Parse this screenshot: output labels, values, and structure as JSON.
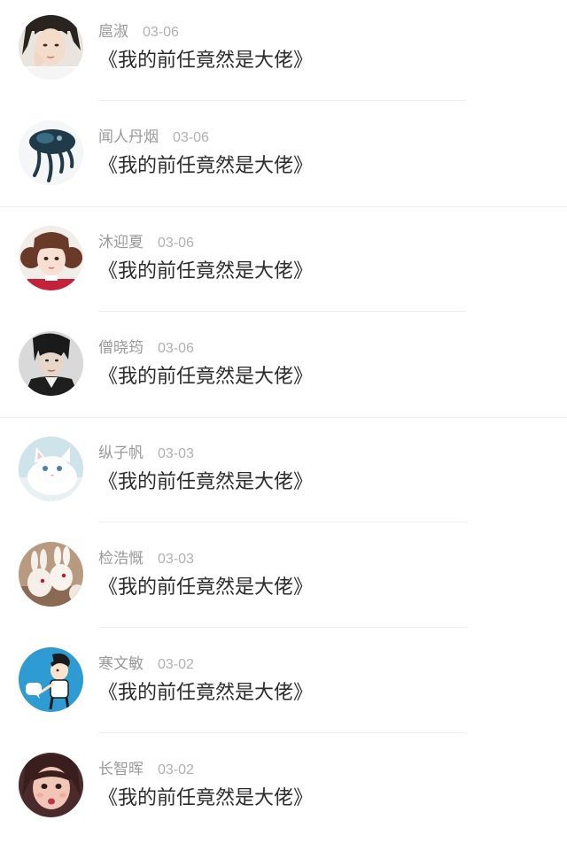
{
  "comments": [
    {
      "user": "扈淑",
      "date": "03-06",
      "book": "《我的前任竟然是大佬》",
      "avatar_icon": "girl-portrait-icon"
    },
    {
      "user": "闻人丹烟",
      "date": "03-06",
      "book": "《我的前任竟然是大佬》",
      "avatar_icon": "jellyfish-art-icon"
    },
    {
      "user": "沐迎夏",
      "date": "03-06",
      "book": "《我的前任竟然是大佬》",
      "avatar_icon": "girl-pigtails-icon"
    },
    {
      "user": "僧晓筠",
      "date": "03-06",
      "book": "《我的前任竟然是大佬》",
      "avatar_icon": "man-portrait-icon"
    },
    {
      "user": "纵子帆",
      "date": "03-03",
      "book": "《我的前任竟然是大佬》",
      "avatar_icon": "white-kitten-icon"
    },
    {
      "user": "检浩慨",
      "date": "03-03",
      "book": "《我的前任竟然是大佬》",
      "avatar_icon": "bunny-figurines-icon"
    },
    {
      "user": "寒文敏",
      "date": "03-02",
      "book": "《我的前任竟然是大佬》",
      "avatar_icon": "cartoon-boy-icon"
    },
    {
      "user": "长智晖",
      "date": "03-02",
      "book": "《我的前任竟然是大佬》",
      "avatar_icon": "girl-closeup-icon"
    }
  ]
}
